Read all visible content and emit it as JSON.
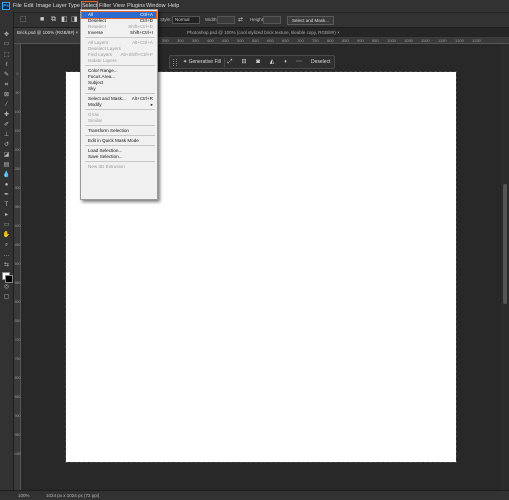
{
  "menubar": {
    "logo": "Ps",
    "items": [
      "File",
      "Edit",
      "Image",
      "Layer",
      "Type",
      "Select",
      "Filter",
      "View",
      "Plugins",
      "Window",
      "Help"
    ],
    "active": "Select"
  },
  "options": {
    "style_label": "Style:",
    "style_value": "Normal",
    "width_label": "Width:",
    "height_label": "Height:",
    "select_mask_button": "Select and Mask..."
  },
  "tabs": [
    {
      "label": "Brick.psd @ 100% (RGB/8#)",
      "active": true
    },
    {
      "label": "Photoshop.psd @ 100% (cool stylized brick texture, tileable copy, RGB/8#)",
      "active": false
    }
  ],
  "ruler": {
    "top_ticks": [
      "250",
      "300",
      "350",
      "400",
      "450",
      "500",
      "550",
      "600",
      "650",
      "700",
      "750",
      "800",
      "850",
      "900",
      "950",
      "1000",
      "1050",
      "1100",
      "1150",
      "1200",
      "1250"
    ],
    "left_ticks": [
      "0",
      "50",
      "100",
      "150",
      "200",
      "250",
      "300",
      "350",
      "400",
      "450",
      "500",
      "550",
      "600",
      "650",
      "700",
      "750",
      "800",
      "850",
      "900",
      "950",
      "1000"
    ]
  },
  "taskbar": {
    "generative_fill": "Generative Fill",
    "deselect": "Deselect"
  },
  "select_menu": [
    {
      "label": "All",
      "shortcut": "Ctrl+A",
      "enabled": true,
      "highlighted": true
    },
    {
      "label": "Deselect",
      "shortcut": "Ctrl+D",
      "enabled": true
    },
    {
      "label": "Reselect",
      "shortcut": "Shift+Ctrl+D",
      "enabled": false
    },
    {
      "label": "Inverse",
      "shortcut": "Shift+Ctrl+I",
      "enabled": true
    },
    {
      "separator": true
    },
    {
      "label": "All Layers",
      "shortcut": "Alt+Ctrl+A",
      "enabled": false
    },
    {
      "label": "Deselect Layers",
      "shortcut": "",
      "enabled": false
    },
    {
      "label": "Find Layers",
      "shortcut": "Alt+Shift+Ctrl+F",
      "enabled": false
    },
    {
      "label": "Isolate Layers",
      "shortcut": "",
      "enabled": false
    },
    {
      "separator": true
    },
    {
      "label": "Color Range...",
      "shortcut": "",
      "enabled": true
    },
    {
      "label": "Focus Area...",
      "shortcut": "",
      "enabled": true
    },
    {
      "label": "Subject",
      "shortcut": "",
      "enabled": true
    },
    {
      "label": "Sky",
      "shortcut": "",
      "enabled": true
    },
    {
      "separator": true
    },
    {
      "label": "Select and Mask...",
      "shortcut": "Alt+Ctrl+R",
      "enabled": true
    },
    {
      "label": "Modify",
      "shortcut": "▸",
      "enabled": true
    },
    {
      "separator": true
    },
    {
      "label": "Grow",
      "shortcut": "",
      "enabled": false
    },
    {
      "label": "Similar",
      "shortcut": "",
      "enabled": false
    },
    {
      "separator": true
    },
    {
      "label": "Transform Selection",
      "shortcut": "",
      "enabled": true
    },
    {
      "separator": true
    },
    {
      "label": "Edit in Quick Mask Mode",
      "shortcut": "",
      "enabled": true
    },
    {
      "separator": true
    },
    {
      "label": "Load Selection...",
      "shortcut": "",
      "enabled": true
    },
    {
      "label": "Save Selection...",
      "shortcut": "",
      "enabled": true
    },
    {
      "separator": true
    },
    {
      "label": "New 3D Extrusion",
      "shortcut": "",
      "enabled": false
    }
  ],
  "status": {
    "zoom": "100%",
    "doc_info": "1024 px x 1024 px (72 ppi)"
  },
  "colors": {
    "accent": "#e8642a",
    "highlight": "#2b6bd0"
  }
}
